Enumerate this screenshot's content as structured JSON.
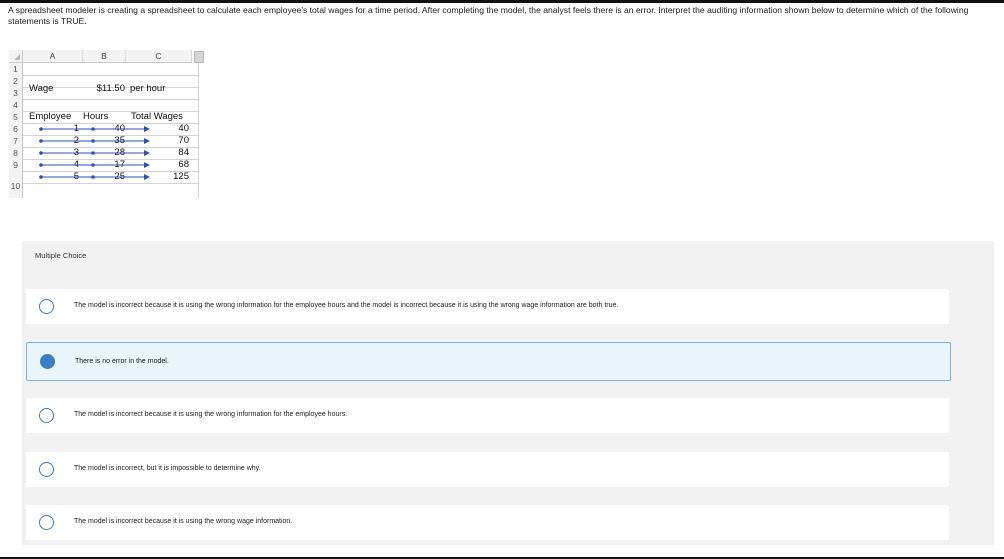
{
  "question": "A spreadsheet modeler is creating a spreadsheet to calculate each employee's total wages for a time period. After completing the model, the analyst feels there is an error. Interpret the auditing information shown below to determine which of the following statements is TRUE.",
  "sheet": {
    "columns": [
      "A",
      "B",
      "C"
    ],
    "rows": [
      "1",
      "2",
      "3",
      "4",
      "5",
      "6",
      "7",
      "8",
      "9",
      "10"
    ],
    "wage_label": "Wage",
    "wage_value": "$11.50",
    "wage_unit": "per hour",
    "header_employee": "Employee",
    "header_hours": "Hours",
    "header_total": "Total Wages",
    "data": [
      {
        "employee": "1",
        "hours": "40",
        "total": "40"
      },
      {
        "employee": "2",
        "hours": "35",
        "total": "70"
      },
      {
        "employee": "3",
        "hours": "28",
        "total": "84"
      },
      {
        "employee": "4",
        "hours": "17",
        "total": "68"
      },
      {
        "employee": "5",
        "hours": "25",
        "total": "125"
      }
    ],
    "trace_color": "#2f4fb5"
  },
  "mc": {
    "title": "Multiple Choice",
    "selected_index": 1,
    "accent": "#3b7ec4",
    "options": [
      "The model is incorrect because it is using the wrong information for the employee hours and the model is incorrect because it is using the wrong wage information are both true.",
      "There is no error in the model.",
      "The model is incorrect because it is using the wrong information for the employee hours.",
      "The model is incorrect, but it is impossible to determine why.",
      "The model is incorrect because it is using the wrong wage information."
    ]
  }
}
